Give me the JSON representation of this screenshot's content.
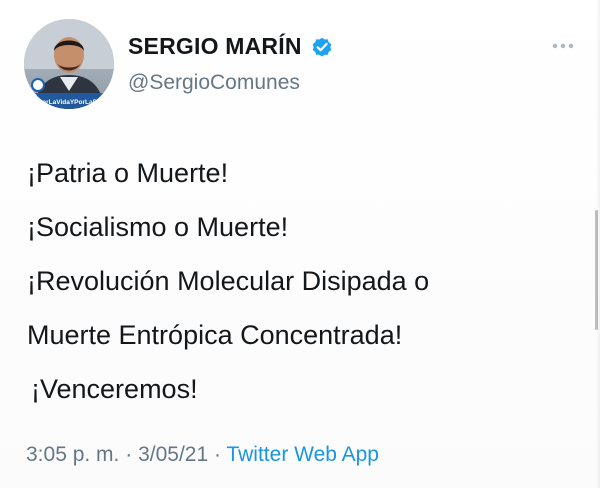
{
  "colors": {
    "text": "#14171a",
    "secondary": "#657786",
    "link": "#1b95e0",
    "verified": "#1da1f2"
  },
  "user": {
    "display_name": "SERGIO MARÍN",
    "handle": "@SergioComunes",
    "verified": true,
    "avatar_caption": "#PorLaVidaYPorLaPaz"
  },
  "tweet": {
    "lines": [
      "¡Patria o Muerte!",
      "¡Socialismo o Muerte!",
      "¡Revolución Molecular Disipada o",
      "Muerte Entrópica Concentrada!",
      "¡Venceremos!"
    ],
    "time": "3:05 p. m.",
    "date": "3/05/21",
    "separator": "·",
    "source": "Twitter Web App"
  },
  "icons": {
    "verified": "verified-badge-icon",
    "more": "more-options-icon"
  }
}
